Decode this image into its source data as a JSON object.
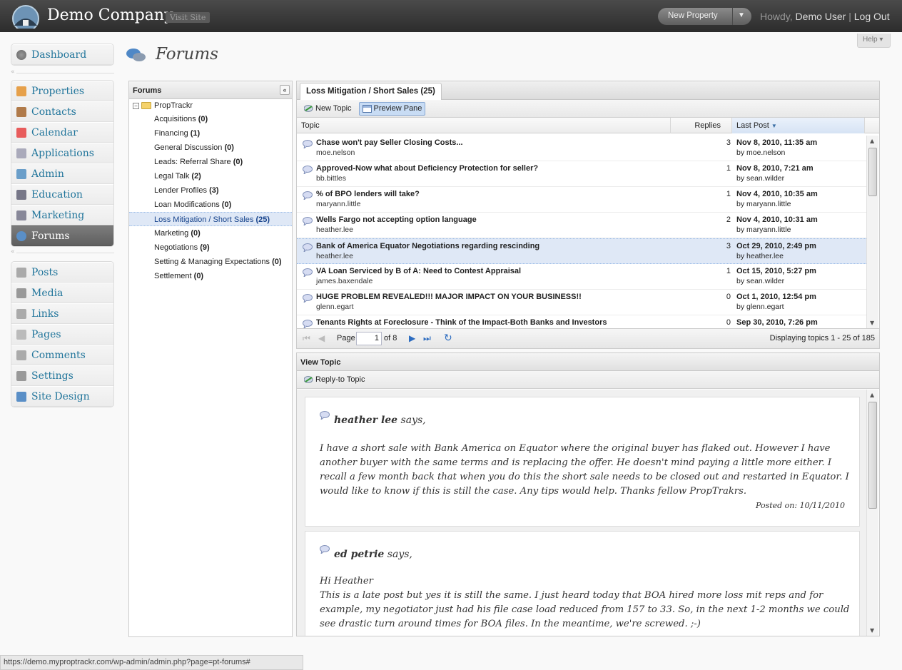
{
  "header": {
    "site_title": "Demo Company",
    "visit_site": "Visit Site",
    "new_property": "New Property",
    "howdy": "Howdy,",
    "user": "Demo User",
    "separator": "|",
    "logout": "Log Out",
    "help": "Help"
  },
  "sidebar": {
    "group1": [
      "Dashboard"
    ],
    "group2": [
      "Properties",
      "Contacts",
      "Calendar",
      "Applications",
      "Admin",
      "Education",
      "Marketing",
      "Forums"
    ],
    "group3": [
      "Posts",
      "Media",
      "Links",
      "Pages",
      "Comments",
      "Settings",
      "Site Design"
    ]
  },
  "page_title": "Forums",
  "tree": {
    "title": "Forums",
    "root": "PropTrackr",
    "items": [
      {
        "name": "Acquisitions",
        "count": "(0)"
      },
      {
        "name": "Financing",
        "count": "(1)"
      },
      {
        "name": "General Discussion",
        "count": "(0)"
      },
      {
        "name": "Leads: Referral Share",
        "count": "(0)"
      },
      {
        "name": "Legal Talk",
        "count": "(2)"
      },
      {
        "name": "Lender Profiles",
        "count": "(3)"
      },
      {
        "name": "Loan Modifications",
        "count": "(0)"
      },
      {
        "name": "Loss Mitigation / Short Sales",
        "count": "(25)"
      },
      {
        "name": "Marketing",
        "count": "(0)"
      },
      {
        "name": "Negotiations",
        "count": "(9)"
      },
      {
        "name": "Setting & Managing Expectations",
        "count": "(0)"
      },
      {
        "name": "Settlement",
        "count": "(0)"
      }
    ]
  },
  "grid": {
    "tab": "Loss Mitigation / Short Sales (25)",
    "new_topic": "New Topic",
    "preview_pane": "Preview Pane",
    "col_topic": "Topic",
    "col_replies": "Replies",
    "col_last": "Last Post",
    "rows": [
      {
        "title": "Chase won't pay Seller Closing Costs...",
        "author": "moe.nelson",
        "replies": "3",
        "date": "Nov 8, 2010, 11:35 am",
        "by": "by moe.nelson"
      },
      {
        "title": "Approved-Now what about Deficiency Protection for seller?",
        "author": "bb.bittles",
        "replies": "1",
        "date": "Nov 8, 2010, 7:21 am",
        "by": "by sean.wilder"
      },
      {
        "title": "% of BPO lenders will take?",
        "author": "maryann.little",
        "replies": "1",
        "date": "Nov 4, 2010, 10:35 am",
        "by": "by maryann.little"
      },
      {
        "title": "Wells Fargo not accepting option language",
        "author": "heather.lee",
        "replies": "2",
        "date": "Nov 4, 2010, 10:31 am",
        "by": "by maryann.little"
      },
      {
        "title": "Bank of America Equator Negotiations regarding rescinding",
        "author": "heather.lee",
        "replies": "3",
        "date": "Oct 29, 2010, 2:49 pm",
        "by": "by heather.lee"
      },
      {
        "title": "VA Loan Serviced by B of A: Need to Contest Appraisal",
        "author": "james.baxendale",
        "replies": "1",
        "date": "Oct 15, 2010, 5:27 pm",
        "by": "by sean.wilder"
      },
      {
        "title": "HUGE PROBLEM REVEALED!!! MAJOR IMPACT ON YOUR BUSINESS!!",
        "author": "glenn.egart",
        "replies": "0",
        "date": "Oct 1, 2010, 12:54 pm",
        "by": "by glenn.egart"
      },
      {
        "title": "Tenants Rights at Foreclosure - Think of the Impact-Both Banks and Investors",
        "author": "",
        "replies": "0",
        "date": "Sep 30, 2010, 7:26 pm",
        "by": ""
      }
    ],
    "page_label": "Page",
    "page_value": "1",
    "page_of": "of 8",
    "displaying": "Displaying topics 1 - 25 of 185"
  },
  "view": {
    "title": "View Topic",
    "reply": "Reply-to Topic",
    "posts": [
      {
        "name": "heather lee",
        "says": "says,",
        "body": "I have a short sale with Bank America on Equator where the original buyer has flaked out. However I have another buyer with the same terms and is replacing the offer. He doesn't mind paying a little more either. I recall a few month back that when you do this the short sale needs to be closed out and restarted in Equator. I would like to know if this is still the case. Any tips would help. Thanks fellow PropTrakrs.",
        "date": "Posted on: 10/11/2010"
      },
      {
        "name": "ed petrie",
        "says": "says,",
        "greet": "Hi Heather",
        "body": "This is a late post but yes it is still the same. I just heard today that BOA hired more loss mit reps and for example, my negotiator just had his file case load reduced from 157 to 33. So, in the next 1-2 months we could see drastic turn around times for BOA files. In the meantime, we're screwed. ;-)"
      }
    ]
  },
  "status_url": "https://demo.myproptrackr.com/wp-admin/admin.php?page=pt-forums#"
}
